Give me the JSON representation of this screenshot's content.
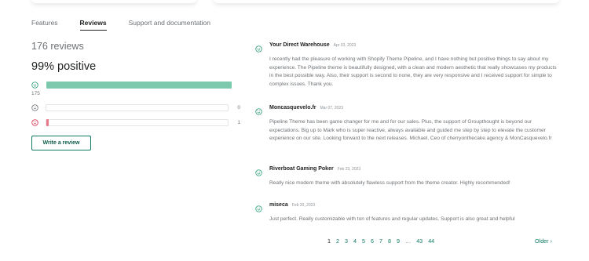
{
  "tabs": [
    {
      "label": "Features"
    },
    {
      "label": "Reviews"
    },
    {
      "label": "Support and documentation"
    }
  ],
  "summary": {
    "count_label": "176 reviews",
    "positive_label": "99% positive",
    "bars": [
      {
        "sentiment": "positive",
        "count": "175",
        "fraction": 1.0,
        "color": "#7dc9ad"
      },
      {
        "sentiment": "neutral",
        "count": "0",
        "fraction": 0.0,
        "color": "#c9cccf"
      },
      {
        "sentiment": "negative",
        "count": "1",
        "fraction": 0.006,
        "color": "#e87a8a"
      }
    ],
    "write_review_label": "Write a review"
  },
  "colors": {
    "accent": "#0d7a62",
    "positive": "#2a9d77",
    "neutral": "#6d7175",
    "negative": "#d72c4a"
  },
  "reviews": [
    {
      "name": "Your Direct Warehouse",
      "date": "Apr 03, 2023",
      "sentiment": "positive",
      "text": "I recently had the pleasure of working with Shopify Theme Pipeline, and I have nothing but positive things to say about my experience. The Pipeline theme is beautifully designed, with a clean and modern aesthetic that really showcases my products in the best possible way. Also, their support is second to none, they are very responsive and I received support for simple to complex issues. Thank you."
    },
    {
      "name": "Moncasquevelo.fr",
      "date": "Mar 07, 2023",
      "sentiment": "positive",
      "text": "Pipeline Theme has been game changer for me and for our sales. Plus, the support of Groupthought is beyond our expectations. Big up to Mark who is super reactive, always available and guided me step by step to elevate the customer experience on our site. Looking forward to the next releases. Michael, Ceo of cherryonthecake.agency & MonCasquevelo.fr"
    },
    {
      "name": "Riverboat Gaming Poker",
      "date": "Feb 23, 2023",
      "sentiment": "positive",
      "text": "Really nice modern theme with absolutely flawless support from the theme creator. Highly recommended!"
    },
    {
      "name": "miseca",
      "date": "Feb 20, 2023",
      "sentiment": "positive",
      "text": "Just perfect. Really customizable with ton of features and regular updates. Support is also great and helpful"
    }
  ],
  "pagination": {
    "pages": [
      "1",
      "2",
      "3",
      "4",
      "5",
      "6",
      "7",
      "8",
      "9",
      "…",
      "43",
      "44"
    ],
    "current": "1",
    "older_label": "Older ›"
  },
  "icons": {
    "positive": "smile-face-icon",
    "neutral": "neutral-face-icon",
    "negative": "sad-face-icon"
  }
}
